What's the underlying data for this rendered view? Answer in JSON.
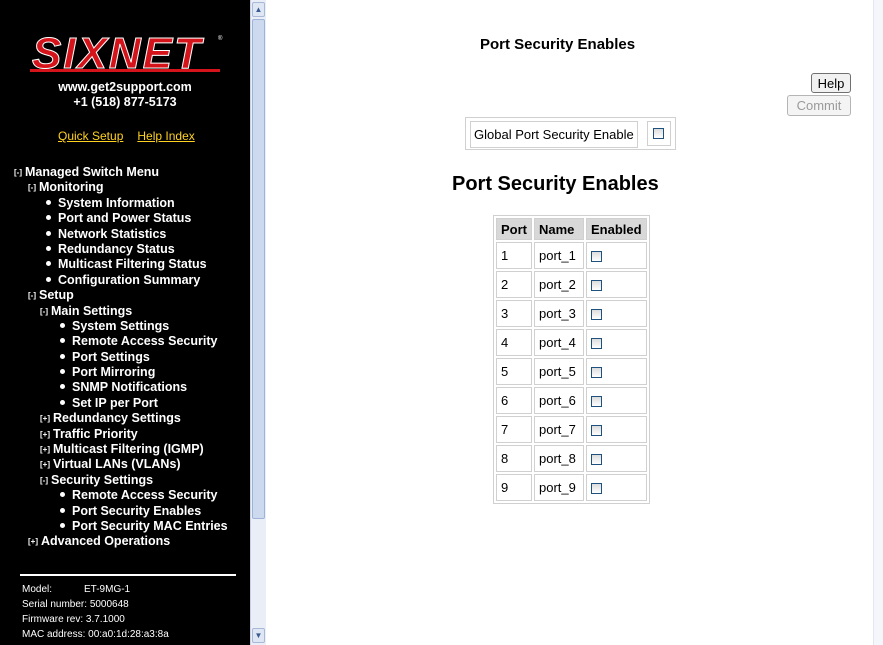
{
  "sidebar": {
    "brand": "SIXNET",
    "website": "www.get2support.com",
    "phone": "+1 (518) 877-5173",
    "quick_setup": "Quick Setup",
    "help_index": "Help Index",
    "menu": [
      {
        "type": "toggle",
        "symbol": "[-]",
        "label": "Managed Switch Menu",
        "indent": 0
      },
      {
        "type": "toggle",
        "symbol": "[-]",
        "label": "Monitoring",
        "indent": 1
      },
      {
        "type": "bullet",
        "label": "System Information",
        "indent": 2
      },
      {
        "type": "bullet",
        "label": "Port and Power Status",
        "indent": 2
      },
      {
        "type": "bullet",
        "label": "Network Statistics",
        "indent": 2
      },
      {
        "type": "bullet",
        "label": "Redundancy Status",
        "indent": 2
      },
      {
        "type": "bullet",
        "label": "Multicast Filtering Status",
        "indent": 2
      },
      {
        "type": "bullet",
        "label": "Configuration Summary",
        "indent": 2
      },
      {
        "type": "toggle",
        "symbol": "[-]",
        "label": "Setup",
        "indent": 1
      },
      {
        "type": "toggle",
        "symbol": "[-]",
        "label": "Main Settings",
        "indent": 2
      },
      {
        "type": "bullet",
        "label": "System Settings",
        "indent": 3
      },
      {
        "type": "bullet",
        "label": "Remote Access Security",
        "indent": 3
      },
      {
        "type": "bullet",
        "label": "Port Settings",
        "indent": 3
      },
      {
        "type": "bullet",
        "label": "Port Mirroring",
        "indent": 3
      },
      {
        "type": "bullet",
        "label": "SNMP Notifications",
        "indent": 3
      },
      {
        "type": "bullet",
        "label": "Set IP per Port",
        "indent": 3
      },
      {
        "type": "toggle",
        "symbol": "[+]",
        "label": "Redundancy Settings",
        "indent": 2
      },
      {
        "type": "toggle",
        "symbol": "[+]",
        "label": "Traffic Priority",
        "indent": 2
      },
      {
        "type": "toggle",
        "symbol": "[+]",
        "label": "Multicast Filtering (IGMP)",
        "indent": 2
      },
      {
        "type": "toggle",
        "symbol": "[+]",
        "label": "Virtual LANs (VLANs)",
        "indent": 2
      },
      {
        "type": "toggle",
        "symbol": "[-]",
        "label": "Security Settings",
        "indent": 2
      },
      {
        "type": "bullet",
        "label": "Remote Access Security",
        "indent": 3
      },
      {
        "type": "bullet",
        "label": "Port Security Enables",
        "indent": 3
      },
      {
        "type": "bullet",
        "label": "Port Security MAC Entries",
        "indent": 3
      },
      {
        "type": "toggle",
        "symbol": "[+]",
        "label": "Advanced Operations",
        "indent": 1
      }
    ],
    "info": {
      "model_label": "Model:",
      "model": "ET-9MG-1",
      "serial_label": "Serial number:",
      "serial": "5000648",
      "firmware_label": "Firmware rev:",
      "firmware": "3.7.1000",
      "mac_label": "MAC address:",
      "mac": "00:a0:1d:28:a3:8a"
    }
  },
  "main": {
    "page_title": "Port Security Enables",
    "help_label": "Help",
    "commit_label": "Commit",
    "global_label": "Global Port Security Enable",
    "global_enabled": false,
    "section_title": "Port Security Enables",
    "table": {
      "headers": [
        "Port",
        "Name",
        "Enabled"
      ],
      "rows": [
        {
          "port": "1",
          "name": "port_1",
          "enabled": false
        },
        {
          "port": "2",
          "name": "port_2",
          "enabled": false
        },
        {
          "port": "3",
          "name": "port_3",
          "enabled": false
        },
        {
          "port": "4",
          "name": "port_4",
          "enabled": false
        },
        {
          "port": "5",
          "name": "port_5",
          "enabled": false
        },
        {
          "port": "6",
          "name": "port_6",
          "enabled": false
        },
        {
          "port": "7",
          "name": "port_7",
          "enabled": false
        },
        {
          "port": "8",
          "name": "port_8",
          "enabled": false
        },
        {
          "port": "9",
          "name": "port_9",
          "enabled": false
        }
      ]
    }
  },
  "colors": {
    "sidebar_bg": "#000000",
    "brand_red": "#d4141a",
    "link_yellow": "#ffd21f",
    "checkbox_border": "#1c5180"
  }
}
